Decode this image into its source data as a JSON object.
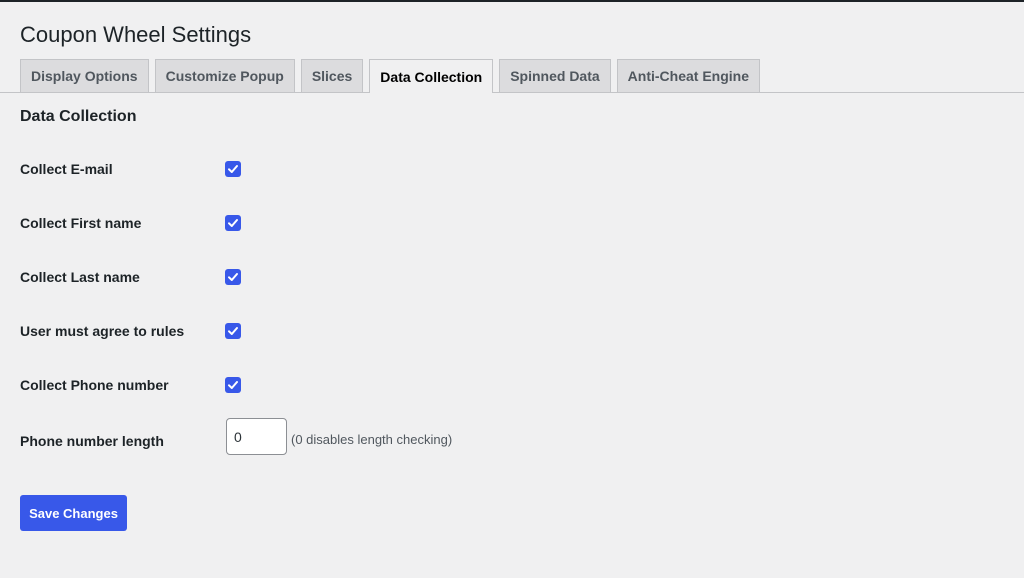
{
  "page": {
    "title": "Coupon Wheel Settings"
  },
  "tabs": [
    {
      "label": "Display Options",
      "active": false
    },
    {
      "label": "Customize Popup",
      "active": false
    },
    {
      "label": "Slices",
      "active": false
    },
    {
      "label": "Data Collection",
      "active": true
    },
    {
      "label": "Spinned Data",
      "active": false
    },
    {
      "label": "Anti-Cheat Engine",
      "active": false
    }
  ],
  "section": {
    "title": "Data Collection"
  },
  "fields": [
    {
      "label": "Collect E-mail",
      "checked": true
    },
    {
      "label": "Collect First name",
      "checked": true
    },
    {
      "label": "Collect Last name",
      "checked": true
    },
    {
      "label": "User must agree to rules",
      "checked": true
    },
    {
      "label": "Collect Phone number",
      "checked": true
    }
  ],
  "phone_length": {
    "label": "Phone number length",
    "value": "0",
    "hint": "(0 disables length checking)"
  },
  "actions": {
    "save_label": "Save Changes"
  },
  "colors": {
    "accent": "#3858e9",
    "background": "#f0f0f1",
    "tab_inactive": "#dcdcde"
  }
}
